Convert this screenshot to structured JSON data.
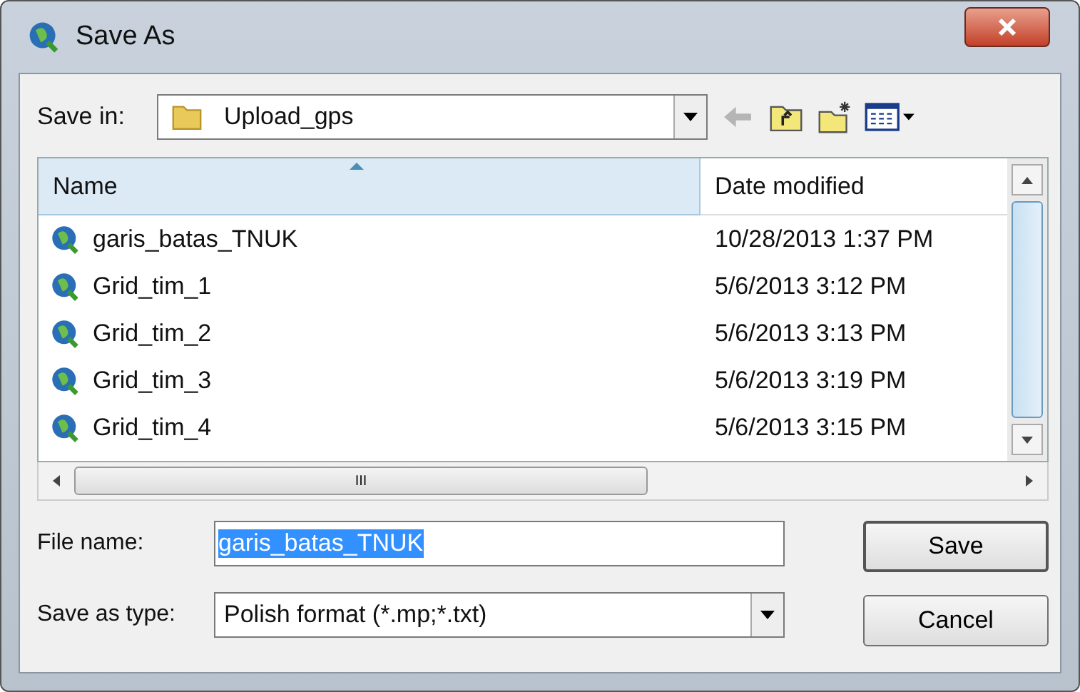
{
  "window": {
    "title": "Save As"
  },
  "save_in": {
    "label": "Save in:",
    "value": "Upload_gps"
  },
  "table": {
    "columns": [
      "Name",
      "Date modified"
    ],
    "rows": [
      {
        "name": "garis_batas_TNUK",
        "date": "10/28/2013 1:37 PM"
      },
      {
        "name": "Grid_tim_1",
        "date": "5/6/2013 3:12 PM"
      },
      {
        "name": "Grid_tim_2",
        "date": "5/6/2013 3:13 PM"
      },
      {
        "name": "Grid_tim_3",
        "date": "5/6/2013 3:19 PM"
      },
      {
        "name": "Grid_tim_4",
        "date": "5/6/2013 3:15 PM"
      }
    ],
    "hscroll_grip": "III"
  },
  "file_name": {
    "label": "File name:",
    "value": "garis_batas_TNUK"
  },
  "save_as_type": {
    "label": "Save as type:",
    "value": "Polish format (*.mp;*.txt)"
  },
  "buttons": [
    "Save",
    "Cancel"
  ]
}
